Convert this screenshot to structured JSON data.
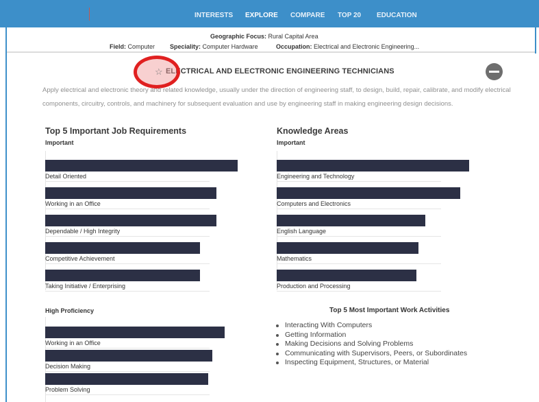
{
  "nav": {
    "items": [
      "INTERESTS",
      "EXPLORE",
      "COMPARE",
      "TOP 20",
      "EDUCATION"
    ],
    "active": "EXPLORE"
  },
  "filters": {
    "geo_label": "Geographic Focus:",
    "geo_value": "Rural Capital Area",
    "field_label": "Field:",
    "field_value": "Computer",
    "speciality_label": "Speciality:",
    "speciality_value": "Computer Hardware",
    "occupation_label": "Occupation:",
    "occupation_value": "Electrical and Electronic Engineering..."
  },
  "occupation": {
    "star_icon": "☆",
    "title": "ELECTRICAL AND ELECTRONIC ENGINEERING TECHNICIANS",
    "description": "Apply electrical and electronic theory and related knowledge, usually under the direction of engineering staff, to design, build, repair, calibrate, and modify electrical components, circuitry, controls, and machinery for subsequent evaluation and use by engineering staff in making engineering design decisions."
  },
  "colors": {
    "nav": "#3d8fc9",
    "bar": "#2c3045",
    "highlight": "#e02020"
  },
  "job_requirements": {
    "title": "Top 5 Important Job Requirements",
    "subtitle": "Important",
    "items": [
      {
        "label": "Detail Oriented",
        "value": 0.92
      },
      {
        "label": "Working in an Office",
        "value": 0.82
      },
      {
        "label": "Dependable / High Integrity",
        "value": 0.82
      },
      {
        "label": "Competitive Achievement",
        "value": 0.74
      },
      {
        "label": "Taking Initiative / Enterprising",
        "value": 0.74
      }
    ]
  },
  "knowledge_areas": {
    "title": "Knowledge Areas",
    "subtitle": "Important",
    "items": [
      {
        "label": "Engineering and Technology",
        "value": 0.92
      },
      {
        "label": "Computers and Electronics",
        "value": 0.88
      },
      {
        "label": "English Language",
        "value": 0.71
      },
      {
        "label": "Mathematics",
        "value": 0.68
      },
      {
        "label": "Production and Processing",
        "value": 0.67
      }
    ]
  },
  "high_proficiency": {
    "title": "High Proficiency",
    "items": [
      {
        "label": "Working in an Office",
        "value": 0.86
      },
      {
        "label": "Decision Making",
        "value": 0.8
      },
      {
        "label": "Problem Solving",
        "value": 0.78
      }
    ]
  },
  "work_activities": {
    "title": "Top 5 Most Important Work Activities",
    "items": [
      "Interacting With Computers",
      "Getting Information",
      "Making Decisions and Solving Problems",
      "Communicating with Supervisors, Peers, or Subordinates",
      "Inspecting Equipment, Structures, or Material"
    ]
  }
}
